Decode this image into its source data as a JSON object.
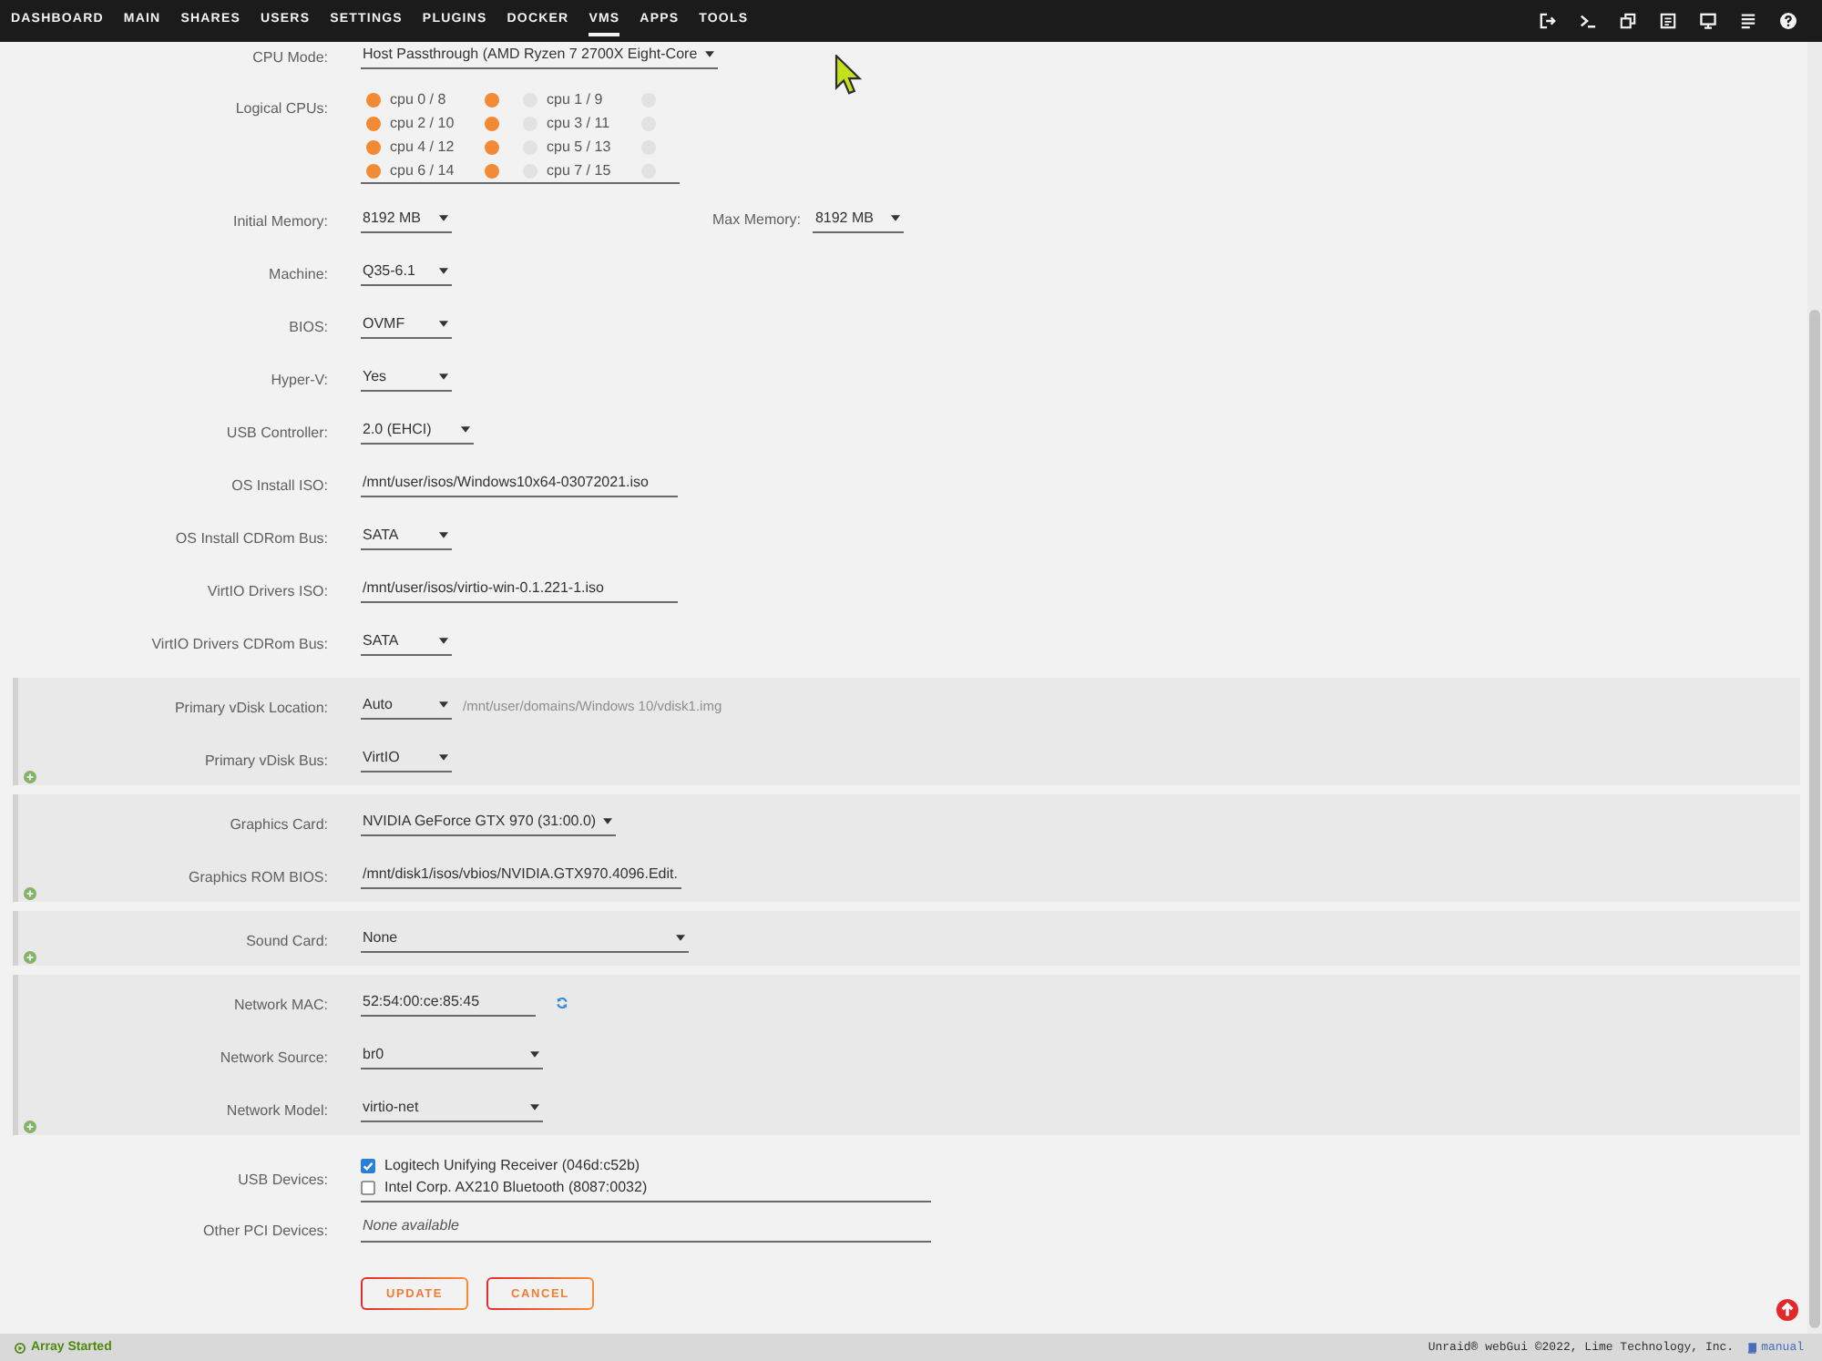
{
  "nav": {
    "items": [
      {
        "label": "DASHBOARD",
        "selected": false
      },
      {
        "label": "MAIN",
        "selected": false
      },
      {
        "label": "SHARES",
        "selected": false
      },
      {
        "label": "USERS",
        "selected": false
      },
      {
        "label": "SETTINGS",
        "selected": false
      },
      {
        "label": "PLUGINS",
        "selected": false
      },
      {
        "label": "DOCKER",
        "selected": false
      },
      {
        "label": "VMS",
        "selected": true
      },
      {
        "label": "APPS",
        "selected": false
      },
      {
        "label": "TOOLS",
        "selected": false
      }
    ]
  },
  "form": [
    {
      "kind": "select",
      "label": "CPU Mode:",
      "value": "Host Passthrough (AMD Ryzen 7 2700X Eight-Core"
    },
    {
      "kind": "cpus",
      "label": "Logical CPUs:",
      "pairs": [
        {
          "label": "cpu 0 / 8",
          "checked": true,
          "sibling_checked": true
        },
        {
          "label": "cpu 1 / 9",
          "checked": false,
          "sibling_checked": false
        },
        {
          "label": "cpu 2 / 10",
          "checked": true,
          "sibling_checked": true
        },
        {
          "label": "cpu 3 / 11",
          "checked": false,
          "sibling_checked": false
        },
        {
          "label": "cpu 4 / 12",
          "checked": true,
          "sibling_checked": true
        },
        {
          "label": "cpu 5 / 13",
          "checked": false,
          "sibling_checked": false
        },
        {
          "label": "cpu 6 / 14",
          "checked": true,
          "sibling_checked": true
        },
        {
          "label": "cpu 7 / 15",
          "checked": false,
          "sibling_checked": false
        }
      ]
    },
    {
      "kind": "memory",
      "label": "Initial Memory:",
      "value": "8192 MB",
      "max_label": "Max Memory:",
      "max_value": "8192 MB"
    },
    {
      "kind": "select",
      "label": "Machine:",
      "value": "Q35-6.1"
    },
    {
      "kind": "select",
      "label": "BIOS:",
      "value": "OVMF"
    },
    {
      "kind": "select",
      "label": "Hyper-V:",
      "value": "Yes"
    },
    {
      "kind": "select",
      "label": "USB Controller:",
      "value": "2.0 (EHCI)"
    },
    {
      "kind": "text",
      "label": "OS Install ISO:",
      "value": "/mnt/user/isos/Windows10x64-03072021.iso"
    },
    {
      "kind": "select",
      "label": "OS Install CDRom Bus:",
      "value": "SATA"
    },
    {
      "kind": "text",
      "label": "VirtIO Drivers ISO:",
      "value": "/mnt/user/isos/virtio-win-0.1.221-1.iso"
    },
    {
      "kind": "select",
      "label": "VirtIO Drivers CDRom Bus:",
      "value": "SATA"
    },
    {
      "kind": "section",
      "rows": [
        {
          "kind": "select",
          "label": "Primary vDisk Location:",
          "value": "Auto",
          "note": "/mnt/user/domains/Windows 10/vdisk1.img"
        },
        {
          "kind": "select",
          "label": "Primary vDisk Bus:",
          "value": "VirtIO"
        }
      ]
    },
    {
      "kind": "section",
      "rows": [
        {
          "kind": "select",
          "label": "Graphics Card:",
          "value": "NVIDIA GeForce GTX 970 (31:00.0)"
        },
        {
          "kind": "text",
          "label": "Graphics ROM BIOS:",
          "value": "/mnt/disk1/isos/vbios/NVIDIA.GTX970.4096.Edit."
        }
      ]
    },
    {
      "kind": "section",
      "rows": [
        {
          "kind": "select",
          "label": "Sound Card:",
          "value": "None"
        }
      ]
    },
    {
      "kind": "section",
      "rows": [
        {
          "kind": "mac",
          "label": "Network MAC:",
          "value": "52:54:00:ce:85:45"
        },
        {
          "kind": "select",
          "label": "Network Source:",
          "value": "br0"
        },
        {
          "kind": "select",
          "label": "Network Model:",
          "value": "virtio-net"
        }
      ]
    },
    {
      "kind": "checklist",
      "label": "USB Devices:",
      "items": [
        {
          "label": "Logitech Unifying Receiver (046d:c52b)",
          "checked": true
        },
        {
          "label": "Intel Corp. AX210 Bluetooth (8087:0032)",
          "checked": false
        }
      ]
    },
    {
      "kind": "note",
      "label": "Other PCI Devices:",
      "value": "None available"
    }
  ],
  "buttons": [
    "UPDATE",
    "CANCEL"
  ],
  "status_bar": {
    "array_status": "Array Started",
    "copyright": "Unraid® webGui ©2022, Lime Technology, Inc.",
    "manual_link": "manual"
  }
}
